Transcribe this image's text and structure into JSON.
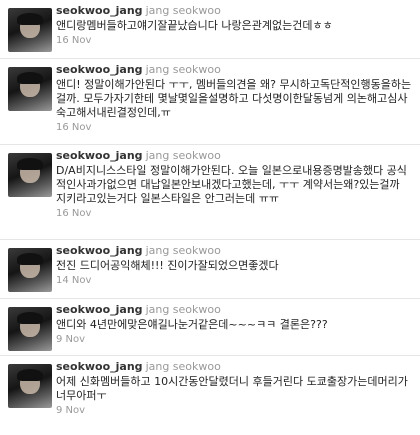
{
  "tweets": [
    {
      "screen_name": "seokwoo_jang",
      "full_name": "jang seokwoo",
      "text": "앤디랑멤버들하고얘기잘끝났습니다 나랑은관계없는건데ㅎㅎ",
      "date": "16 Nov"
    },
    {
      "screen_name": "seokwoo_jang",
      "full_name": "jang seokwoo",
      "text": "앤디! 정말이해가안된다 ㅜㅜ, 멤버들의견을 왜? 무시하고독단적인행동을하는걸까. 모두가자기한테 몇날몇일을설명하고 다섯명이한달동넘게 의논해고심사숙고해서내린결정인데,ㅠ",
      "date": "16 Nov"
    },
    {
      "screen_name": "seokwoo_jang",
      "full_name": "jang seokwoo",
      "text": "D/A비지니스스타일 정말이해가안된다. 오늘 일본으로내용증명발송했다 공식적인사과가없으면 대납일본안보내겠다고했는데, ㅜㅜ 계약서는왜?있는걸까 지키라고있는거다 일본스타일은 안그러는데 ㅠㅠ",
      "date": "16 Nov"
    },
    {
      "screen_name": "seokwoo_jang",
      "full_name": "jang seokwoo",
      "text": "전진 드디어공익해체!!! 진이가잘되었으면좋겠다",
      "date": "14 Nov"
    },
    {
      "screen_name": "seokwoo_jang",
      "full_name": "jang seokwoo",
      "text": "앤디와 4년만에맞은얘길나눈거같은데~~~ㅋㅋ 결론은???",
      "date": "9 Nov"
    },
    {
      "screen_name": "seokwoo_jang",
      "full_name": "jang seokwoo",
      "text": "어제 신화멤버들하고 10시간동안달렸더니 후들거린다 도쿄출장가는데머리가너무아퍼ㅜ",
      "date": "9 Nov"
    }
  ]
}
